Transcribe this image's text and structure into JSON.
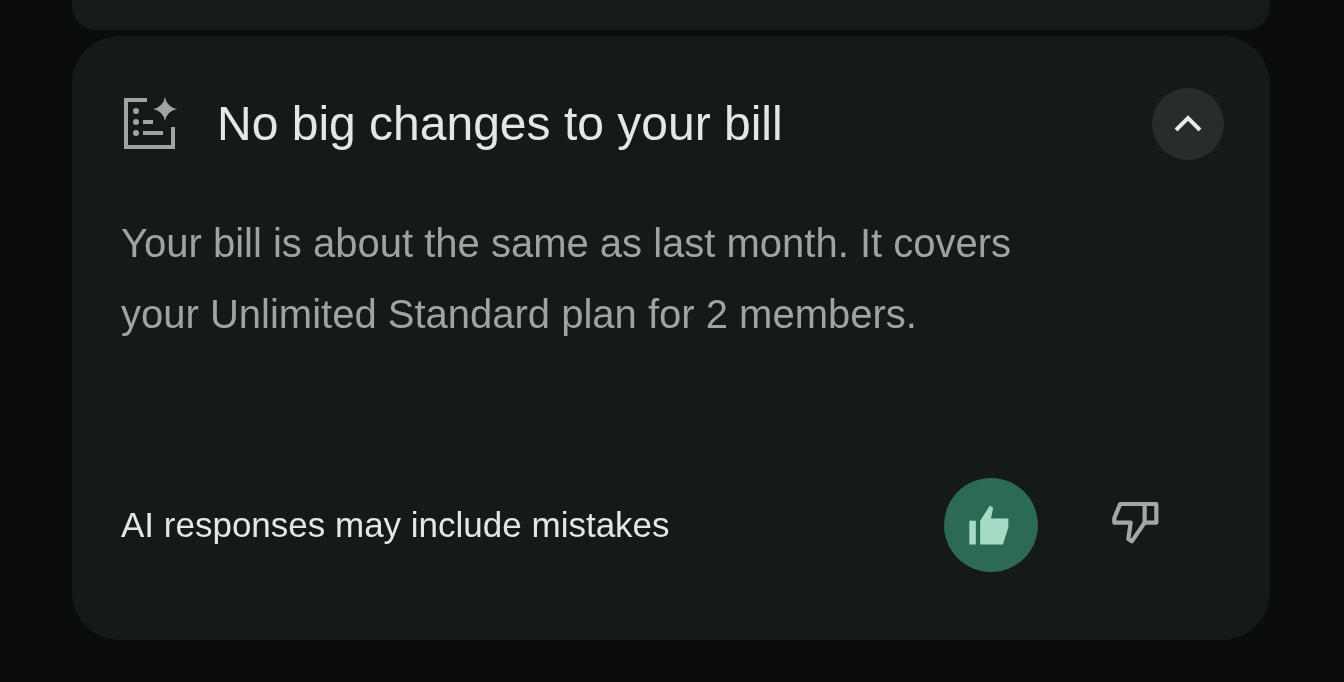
{
  "card": {
    "title": "No big changes to your bill",
    "expanded": true,
    "body": "Your bill is about the same as last month. It covers your Unlimited Standard plan for 2 members.",
    "disclaimer": "AI responses may include mistakes",
    "feedback": [
      {
        "kind": "up",
        "selected": true
      },
      {
        "kind": "down",
        "selected": false
      }
    ]
  }
}
